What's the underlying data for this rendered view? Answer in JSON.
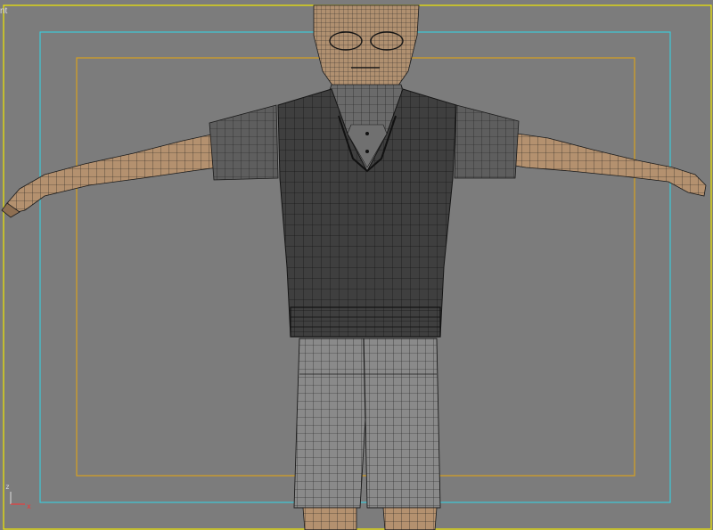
{
  "viewport": {
    "label": "nt",
    "colors": {
      "background": "#7c7c7c",
      "viewport_border": "#f0e800",
      "safe_frame_outer": "#3ec8d8",
      "safe_frame_inner": "#d8a020",
      "skin": "#b49270",
      "vest": "#3e3e3e",
      "shirt": "#6c6c6c",
      "shorts": "#8e8e8e",
      "wire": "#1e1e1e",
      "axis_x": "#ff3030"
    },
    "axis_gizmo": {
      "z_label": "z",
      "x_label": "x",
      "gizmo_icon": "axis-gizmo-icon"
    },
    "model_icon": "character-mesh-wireframe"
  }
}
